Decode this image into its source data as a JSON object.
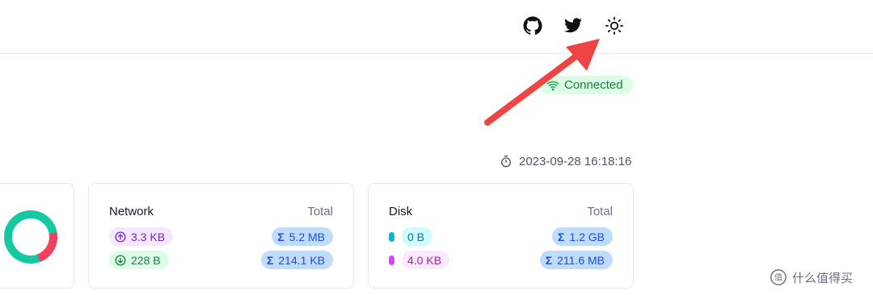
{
  "header": {
    "icons": [
      "github-icon",
      "twitter-icon",
      "sun-icon"
    ]
  },
  "status": {
    "connected_label": "Connected",
    "color": "#15803d"
  },
  "timestamp": "2023-09-28 16:18:16",
  "donut": {
    "values": [
      0.78,
      0.22
    ],
    "colors": [
      "#14c8a4",
      "#f43f5e"
    ]
  },
  "network": {
    "title": "Network",
    "total_label": "Total",
    "upload": "3.3 KB",
    "download": "228 B",
    "total_upload": "5.2 MB",
    "total_download": "214.1 KB"
  },
  "disk": {
    "title": "Disk",
    "total_label": "Total",
    "read": "0 B",
    "write": "4.0 KB",
    "total_read": "1.2 GB",
    "total_write": "211.6 MB",
    "read_color": "#06b6d4",
    "write_color": "#d946ef"
  },
  "watermark": {
    "text": "什么值得买"
  },
  "annotation": {
    "arrow_color": "#ef4444"
  }
}
